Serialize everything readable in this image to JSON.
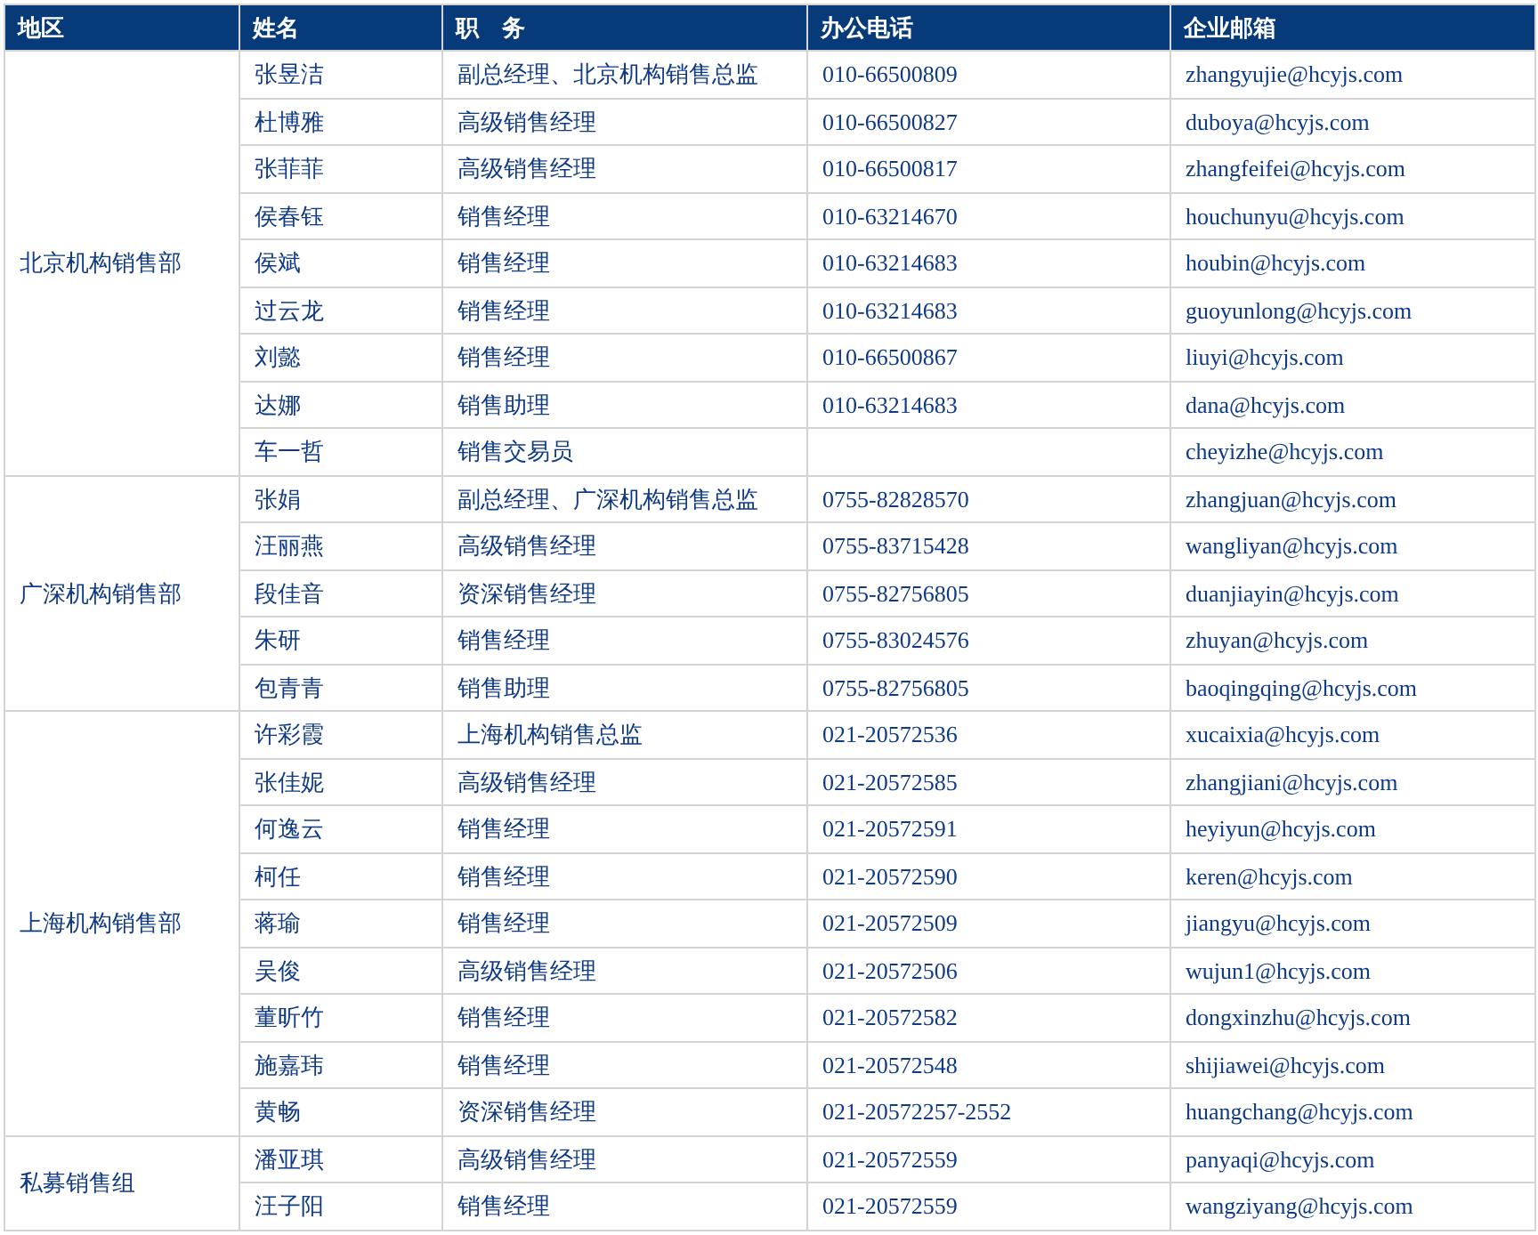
{
  "table": {
    "columns": [
      "地区",
      "姓名",
      "职　务",
      "办公电话",
      "企业邮箱"
    ],
    "groups": [
      {
        "region": "北京机构销售部",
        "rows": [
          {
            "name": "张昱洁",
            "title": "副总经理、北京机构销售总监",
            "phone": "010-66500809",
            "email": "zhangyujie@hcyjs.com"
          },
          {
            "name": "杜博雅",
            "title": "高级销售经理",
            "phone": "010-66500827",
            "email": "duboya@hcyjs.com"
          },
          {
            "name": "张菲菲",
            "title": "高级销售经理",
            "phone": "010-66500817",
            "email": "zhangfeifei@hcyjs.com"
          },
          {
            "name": "侯春钰",
            "title": "销售经理",
            "phone": "010-63214670",
            "email": "houchunyu@hcyjs.com"
          },
          {
            "name": "侯斌",
            "title": "销售经理",
            "phone": "010-63214683",
            "email": "houbin@hcyjs.com"
          },
          {
            "name": "过云龙",
            "title": "销售经理",
            "phone": "010-63214683",
            "email": "guoyunlong@hcyjs.com"
          },
          {
            "name": "刘懿",
            "title": "销售经理",
            "phone": "010-66500867",
            "email": "liuyi@hcyjs.com"
          },
          {
            "name": "达娜",
            "title": "销售助理",
            "phone": "010-63214683",
            "email": "dana@hcyjs.com"
          },
          {
            "name": "车一哲",
            "title": "销售交易员",
            "email": "cheyizhe@hcyjs.com"
          }
        ]
      },
      {
        "region": "广深机构销售部",
        "rows": [
          {
            "name": "张娟",
            "title": "副总经理、广深机构销售总监",
            "phone": "0755-82828570",
            "email": "zhangjuan@hcyjs.com"
          },
          {
            "name": "汪丽燕",
            "title": "高级销售经理",
            "phone": "0755-83715428",
            "email": "wangliyan@hcyjs.com"
          },
          {
            "name": "段佳音",
            "title": "资深销售经理",
            "phone": "0755-82756805",
            "email": "duanjiayin@hcyjs.com"
          },
          {
            "name": "朱研",
            "title": "销售经理",
            "phone": "0755-83024576",
            "email": "zhuyan@hcyjs.com"
          },
          {
            "name": "包青青",
            "title": "销售助理",
            "phone": "0755-82756805",
            "email": "baoqingqing@hcyjs.com"
          }
        ]
      },
      {
        "region": "上海机构销售部",
        "rows": [
          {
            "name": "许彩霞",
            "title": "上海机构销售总监",
            "phone": "021-20572536",
            "email": "xucaixia@hcyjs.com"
          },
          {
            "name": "张佳妮",
            "title": "高级销售经理",
            "phone": "021-20572585",
            "email": "zhangjiani@hcyjs.com"
          },
          {
            "name": "何逸云",
            "title": "销售经理",
            "phone": "021-20572591",
            "email": "heyiyun@hcyjs.com"
          },
          {
            "name": "柯任",
            "title": "销售经理",
            "phone": "021-20572590",
            "email": "keren@hcyjs.com"
          },
          {
            "name": "蒋瑜",
            "title": "销售经理",
            "phone": "021-20572509",
            "email": "jiangyu@hcyjs.com"
          },
          {
            "name": "吴俊",
            "title": "高级销售经理",
            "phone": "021-20572506",
            "email": "wujun1@hcyjs.com"
          },
          {
            "name": "董昕竹",
            "title": "销售经理",
            "phone": "021-20572582",
            "email": "dongxinzhu@hcyjs.com"
          },
          {
            "name": "施嘉玮",
            "title": "销售经理",
            "phone": "021-20572548",
            "email": "shijiawei@hcyjs.com"
          },
          {
            "name": "黄畅",
            "title": "资深销售经理",
            "phone": "021-20572257-2552",
            "email": "huangchang@hcyjs.com"
          }
        ]
      },
      {
        "region": "私募销售组",
        "rows": [
          {
            "name": "潘亚琪",
            "title": "高级销售经理",
            "phone": "021-20572559",
            "email": "panyaqi@hcyjs.com"
          },
          {
            "name": "汪子阳",
            "title": "销售经理",
            "phone": "021-20572559",
            "email": "wangziyang@hcyjs.com"
          }
        ]
      }
    ]
  }
}
